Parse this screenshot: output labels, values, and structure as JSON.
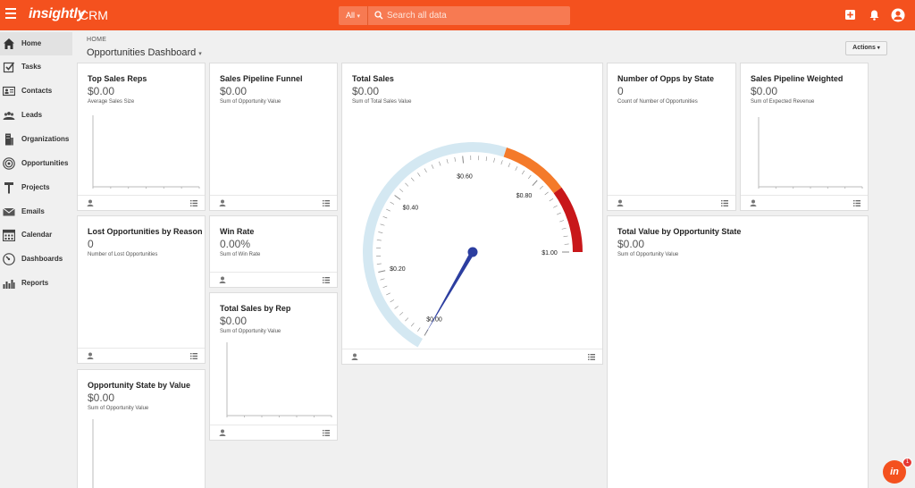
{
  "topbar": {
    "logo": "insightly",
    "app_name": "CRM",
    "search_scope": "All",
    "search_placeholder": "Search all data"
  },
  "sidebar": {
    "items": [
      {
        "label": "Home",
        "icon": "home-icon"
      },
      {
        "label": "Tasks",
        "icon": "tasks-icon"
      },
      {
        "label": "Contacts",
        "icon": "contacts-icon"
      },
      {
        "label": "Leads",
        "icon": "leads-icon"
      },
      {
        "label": "Organizations",
        "icon": "organizations-icon"
      },
      {
        "label": "Opportunities",
        "icon": "opportunities-icon"
      },
      {
        "label": "Projects",
        "icon": "projects-icon"
      },
      {
        "label": "Emails",
        "icon": "emails-icon"
      },
      {
        "label": "Calendar",
        "icon": "calendar-icon"
      },
      {
        "label": "Dashboards",
        "icon": "dashboards-icon"
      },
      {
        "label": "Reports",
        "icon": "reports-icon"
      }
    ]
  },
  "header": {
    "breadcrumb": "HOME",
    "title": "Opportunities Dashboard",
    "actions_label": "Actions"
  },
  "cards": {
    "top_sales_reps": {
      "title": "Top Sales Reps",
      "value": "$0.00",
      "subtitle": "Average Sales Size"
    },
    "sales_pipeline_funnel": {
      "title": "Sales Pipeline Funnel",
      "value": "$0.00",
      "subtitle": "Sum of Opportunity Value"
    },
    "total_sales": {
      "title": "Total Sales",
      "value": "$0.00",
      "subtitle": "Sum of Total Sales Value"
    },
    "opps_by_state": {
      "title": "Number of Opps by State",
      "value": "0",
      "subtitle": "Count of Number of Opportunities"
    },
    "pipeline_weighted": {
      "title": "Sales Pipeline Weighted",
      "value": "$0.00",
      "subtitle": "Sum of Expected Revenue"
    },
    "lost_opportunities": {
      "title": "Lost Opportunities by Reason",
      "value": "0",
      "subtitle": "Number of Lost Opportunities"
    },
    "win_rate": {
      "title": "Win Rate",
      "value": "0.00%",
      "subtitle": "Sum of Win Rate"
    },
    "total_value_by_state": {
      "title": "Total Value by Opportunity State",
      "value": "$0.00",
      "subtitle": "Sum of Opportunity Value"
    },
    "total_sales_by_rep": {
      "title": "Total Sales by Rep",
      "value": "$0.00",
      "subtitle": "Sum of Opportunity Value"
    },
    "state_by_value": {
      "title": "Opportunity State by Value",
      "value": "$0.00",
      "subtitle": "Sum of Opportunity Value"
    }
  },
  "gauge": {
    "tick_labels": [
      "$0.00",
      "$0.20",
      "$0.40",
      "$0.60",
      "$0.80",
      "$1.00"
    ],
    "min": 0,
    "max": 1,
    "value": 0,
    "band_colors": {
      "normal": "#d4e8f2",
      "warning": "#f47a2a",
      "danger": "#c8171a"
    },
    "bands": [
      {
        "from": 0,
        "to": 0.7
      },
      {
        "from": 0.7,
        "to": 0.85
      },
      {
        "from": 0.85,
        "to": 1
      }
    ],
    "needle_color": "#2c3ea0"
  },
  "fab": {
    "label": "in",
    "badge": "1"
  },
  "colors": {
    "brand": "#f4511e"
  }
}
